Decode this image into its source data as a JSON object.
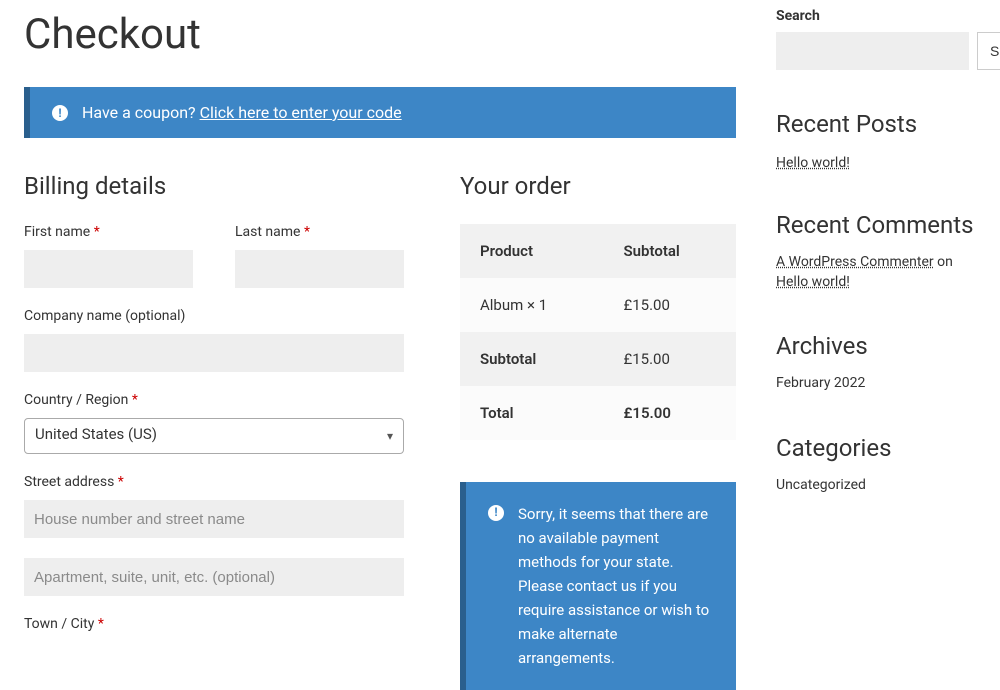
{
  "page_title": "Checkout",
  "coupon_notice": {
    "prefix": "Have a coupon? ",
    "link": "Click here to enter your code"
  },
  "billing": {
    "heading": "Billing details",
    "first_name_label": "First name ",
    "last_name_label": "Last name ",
    "company_label": "Company name (optional)",
    "country_label": "Country / Region ",
    "country_value": "United States (US)",
    "street_label": "Street address ",
    "street_placeholder": "House number and street name",
    "street2_placeholder": "Apartment, suite, unit, etc. (optional)",
    "town_label": "Town / City ",
    "asterisk": "*"
  },
  "order": {
    "heading": "Your order",
    "col_product": "Product",
    "col_subtotal": "Subtotal",
    "item_name": "Album  × 1",
    "item_price": "£15.00",
    "subtotal_label": "Subtotal",
    "subtotal_value": "£15.00",
    "total_label": "Total",
    "total_value": "£15.00"
  },
  "payment_error": "Sorry, it seems that there are no available payment methods for your state. Please contact us if you require assistance or wish to make alternate arrangements.",
  "sidebar": {
    "search_label": "Search",
    "search_button": "Search",
    "recent_posts_title": "Recent Posts",
    "recent_post_1": "Hello world!",
    "recent_comments_title": "Recent Comments",
    "commenter": "A WordPress Commenter",
    "on_text": " on ",
    "comment_post": "Hello world!",
    "archives_title": "Archives",
    "archive_1": "February 2022",
    "categories_title": "Categories",
    "category_1": "Uncategorized"
  }
}
